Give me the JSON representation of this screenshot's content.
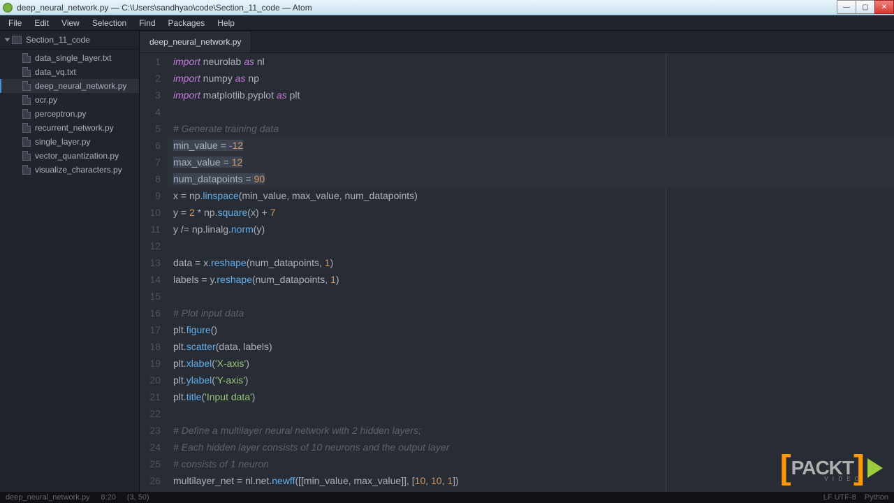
{
  "window": {
    "title": "deep_neural_network.py — C:\\Users\\sandhyao\\code\\Section_11_code — Atom"
  },
  "menu": {
    "file": "File",
    "edit": "Edit",
    "view": "View",
    "selection": "Selection",
    "find": "Find",
    "packages": "Packages",
    "help": "Help"
  },
  "sidebar": {
    "project": "Section_11_code",
    "files": {
      "f0": "data_single_layer.txt",
      "f1": "data_vq.txt",
      "f2": "deep_neural_network.py",
      "f3": "ocr.py",
      "f4": "perceptron.py",
      "f5": "recurrent_network.py",
      "f6": "single_layer.py",
      "f7": "vector_quantization.py",
      "f8": "visualize_characters.py"
    }
  },
  "tab": {
    "name": "deep_neural_network.py"
  },
  "gutter": {
    "l1": "1",
    "l2": "2",
    "l3": "3",
    "l4": "4",
    "l5": "5",
    "l6": "6",
    "l7": "7",
    "l8": "8",
    "l9": "9",
    "l10": "10",
    "l11": "11",
    "l12": "12",
    "l13": "13",
    "l14": "14",
    "l15": "15",
    "l16": "16",
    "l17": "17",
    "l18": "18",
    "l19": "19",
    "l20": "20",
    "l21": "21",
    "l22": "22",
    "l23": "23",
    "l24": "24",
    "l25": "25",
    "l26": "26"
  },
  "code": {
    "imp": "import",
    "as": "as",
    "l1a": " neurolab ",
    "l1b": " nl",
    "l2a": " numpy ",
    "l2b": " np",
    "l3a": " matplotlib.pyplot ",
    "l3b": " plt",
    "c5": "# Generate training data",
    "l6a": "min_value = ",
    "l6b": "-",
    "l6c": "12",
    "l7a": "max_value = ",
    "l7b": "12",
    "l8a": "num_datapoints = ",
    "l8b": "90",
    "l9a": "x = np.",
    "l9b": "linspace",
    "l9c": "(min_value, max_value, num_datapoints)",
    "l10a": "y = ",
    "l10b": "2",
    "l10c": " * np.",
    "l10d": "square",
    "l10e": "(x) + ",
    "l10f": "7",
    "l11a": "y /= np.linalg.",
    "l11b": "norm",
    "l11c": "(y)",
    "l13a": "data = x.",
    "l13b": "reshape",
    "l13c": "(num_datapoints, ",
    "l13d": "1",
    "l13e": ")",
    "l14a": "labels = y.",
    "l14b": "reshape",
    "l14c": "(num_datapoints, ",
    "l14d": "1",
    "l14e": ")",
    "c16": "# Plot input data",
    "l17a": "plt.",
    "l17b": "figure",
    "l17c": "()",
    "l18a": "plt.",
    "l18b": "scatter",
    "l18c": "(data, labels)",
    "l19a": "plt.",
    "l19b": "xlabel",
    "l19c": "(",
    "l19d": "'X-axis'",
    "l19e": ")",
    "l20a": "plt.",
    "l20b": "ylabel",
    "l20c": "(",
    "l20d": "'Y-axis'",
    "l20e": ")",
    "l21a": "plt.",
    "l21b": "title",
    "l21c": "(",
    "l21d": "'Input data'",
    "l21e": ")",
    "c23": "# Define a multilayer neural network with 2 hidden layers;",
    "c24": "# Each hidden layer consists of 10 neurons and the output layer",
    "c25": "# consists of 1 neuron",
    "l26a": "multilayer_net = nl.net.",
    "l26b": "newff",
    "l26c": "([[min_value, max_value]], [",
    "l26d": "10",
    "l26e": ", ",
    "l26f": "10",
    "l26g": ", ",
    "l26h": "1",
    "l26i": "])"
  },
  "status": {
    "file": "deep_neural_network.py",
    "pos": "8:20",
    "sel": "(3, 50)",
    "encoding": "LF  UTF-8",
    "lang": "Python"
  },
  "watermark": {
    "brand": "PACKT",
    "sub": "V I D E O"
  }
}
